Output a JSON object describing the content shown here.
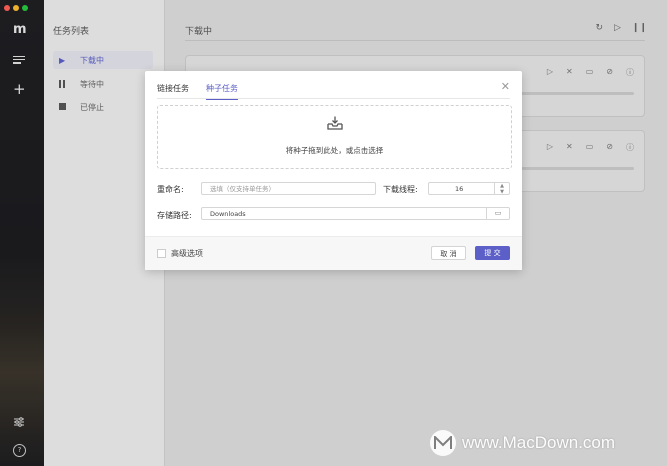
{
  "app": {
    "logo_text": "m"
  },
  "sidebar": {
    "add_label": "+",
    "help_label": "?"
  },
  "task_panel": {
    "title": "任务列表",
    "items": [
      {
        "label": "下载中",
        "icon": "play-icon",
        "active": true
      },
      {
        "label": "等待中",
        "icon": "pause-icon",
        "active": false
      },
      {
        "label": "已停止",
        "icon": "stop-icon",
        "active": false
      }
    ]
  },
  "main": {
    "title": "下载中",
    "tools": [
      "refresh-icon",
      "play-icon",
      "pause-icon"
    ],
    "card_tools": [
      "play-icon",
      "close-icon",
      "folder-icon",
      "link-icon",
      "info-icon"
    ]
  },
  "dialog": {
    "tabs": [
      {
        "label": "链接任务",
        "active": false
      },
      {
        "label": "种子任务",
        "active": true
      }
    ],
    "drop_text": "将种子拖到此处，或点击选择",
    "rename_label": "重命名:",
    "rename_placeholder": "选填（仅支持单任务）",
    "threads_label": "下载线程:",
    "threads_value": "16",
    "path_label": "存储路径:",
    "path_value": "Downloads",
    "advanced_label": "高级选项",
    "cancel_label": "取 消",
    "submit_label": "提 交"
  },
  "watermark": {
    "text": "www.MacDown.com"
  },
  "colors": {
    "accent": "#5b5fc7",
    "rail": "#1f1f22"
  }
}
